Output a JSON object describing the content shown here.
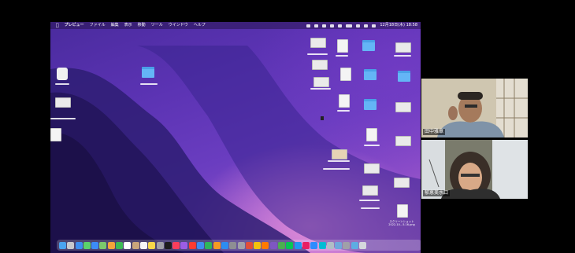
{
  "menubar": {
    "apple": "",
    "items": [
      "プレビュー",
      "ファイル",
      "編集",
      "表示",
      "移動",
      "ツール",
      "ウインドウ",
      "ヘルプ"
    ],
    "clock": "12月18日(木) 18:58"
  },
  "desktop": {
    "file_label": "スクリーンショット 2022-10...5.16.png"
  },
  "participants": [
    {
      "name": "田中雅章"
    },
    {
      "name": "郁恵美水口"
    }
  ]
}
